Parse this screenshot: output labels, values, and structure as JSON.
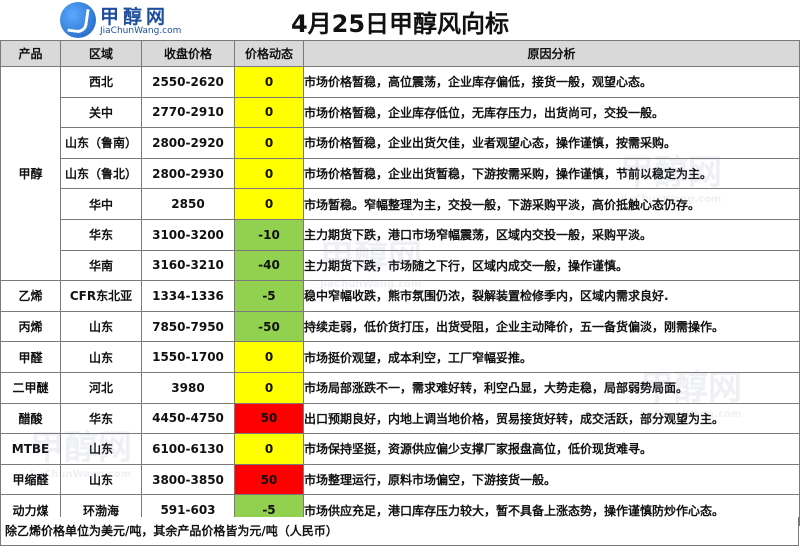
{
  "header": {
    "logo_cn": "甲醇网",
    "logo_en": "JiaChunWang.com",
    "title": "4月25日甲醇风向标"
  },
  "columns": [
    "产品",
    "区域",
    "收盘价格",
    "价格动态",
    "原因分析"
  ],
  "rows": [
    {
      "product": "甲醇",
      "rowspan": 7,
      "region": "西北",
      "price": "2550-2620",
      "change": "0",
      "change_color": "#ffff00",
      "reason": "市场价格暂稳，高位震荡，企业库存偏低，接货一般，观望心态。"
    },
    {
      "region": "关中",
      "price": "2770-2910",
      "change": "0",
      "change_color": "#ffff00",
      "reason": "市场价格暂稳，企业库存低位，无库存压力，出货尚可，交投一般。"
    },
    {
      "region": "山东（鲁南）",
      "price": "2800-2920",
      "change": "0",
      "change_color": "#ffff00",
      "reason": "市场价格暂稳，企业出货欠佳，业者观望心态，操作谨慎，按需采购。"
    },
    {
      "region": "山东（鲁北）",
      "price": "2800-2930",
      "change": "0",
      "change_color": "#ffff00",
      "reason": "市场价格暂稳，企业出货暂稳，下游按需采购，操作谨慎，节前以稳定为主。"
    },
    {
      "region": "华中",
      "price": "2850",
      "change": "0",
      "change_color": "#ffff00",
      "reason": "市场暂稳。窄幅整理为主，交投一般，下游采购平淡，高价抵触心态仍存。"
    },
    {
      "region": "华东",
      "price": "3100-3200",
      "change": "-10",
      "change_color": "#92d050",
      "reason": "主力期货下跌，港口市场窄幅震荡，区域内交投一般，采购平淡。"
    },
    {
      "region": "华南",
      "price": "3160-3210",
      "change": "-40",
      "change_color": "#92d050",
      "reason": "主力期货下跌，市场随之下行，区域内成交一般，操作谨慎。"
    },
    {
      "product": "乙烯",
      "region": "CFR东北亚",
      "price": "1334-1336",
      "change": "-5",
      "change_color": "#92d050",
      "reason": "稳中窄幅收跌，熊市氛围仍浓，裂解装置检修季内，区域内需求良好."
    },
    {
      "product": "丙烯",
      "region": "山东",
      "price": "7850-7950",
      "change": "-50",
      "change_color": "#92d050",
      "reason": "持续走弱，低价货打压，出货受阻，企业主动降价，五一备货偏淡，刚需操作。"
    },
    {
      "product": "甲醛",
      "region": "山东",
      "price": "1550-1700",
      "change": "0",
      "change_color": "#ffff00",
      "reason": "市场挺价观望，成本利空，工厂窄幅妥推。"
    },
    {
      "product": "二甲醚",
      "region": "河北",
      "price": "3980",
      "change": "0",
      "change_color": "#ffff00",
      "reason": "市场局部涨跌不一，需求难好转，利空凸显，大势走稳，局部弱势局面。"
    },
    {
      "product": "醋酸",
      "region": "华东",
      "price": "4450-4750",
      "change": "50",
      "change_color": "#ff0000",
      "reason": "出口预期良好，内地上调当地价格，贸易接货好转，成交活跃，部分观望为主。"
    },
    {
      "product": "MTBE",
      "region": "山东",
      "price": "6100-6130",
      "change": "0",
      "change_color": "#ffff00",
      "reason": "市场保持坚挺，资源供应偏少支撑厂家报盘高位，低价现货难寻。"
    },
    {
      "product": "甲缩醛",
      "region": "山东",
      "price": "3800-3850",
      "change": "50",
      "change_color": "#ff0000",
      "reason": "市场整理运行，原料市场偏空，下游接货一般。"
    },
    {
      "product": "动力煤",
      "region": "环渤海",
      "price": "591-603",
      "change": "-5",
      "change_color": "#92d050",
      "reason": "市场供应充足，港口库存压力较大，暂不具备上涨态势，操作谨慎防炒作心态。"
    }
  ],
  "footnote": "除乙烯价格单位为美元/吨，其余产品价格皆为元/吨（人民币）",
  "watermark": {
    "cn": "甲醇网",
    "en": "JiaChunWang.com"
  }
}
